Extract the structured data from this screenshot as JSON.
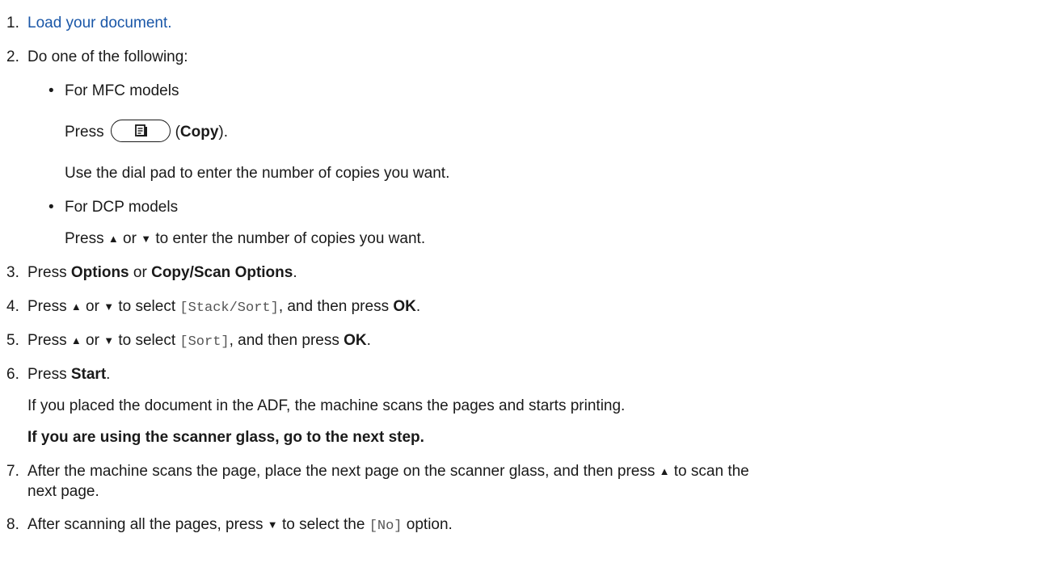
{
  "steps": {
    "s1": {
      "num": "1.",
      "link": "Load your document."
    },
    "s2": {
      "num": "2.",
      "text": "Do one of the following:"
    },
    "s2_mfc": {
      "bullet": "•",
      "heading": "For MFC models",
      "press": "Press",
      "button_icon": "copy-icon",
      "paren_open": "(",
      "button_label": "Copy",
      "paren_close": ").",
      "dial": "Use the dial pad to enter the number of copies you want."
    },
    "s2_dcp": {
      "bullet": "•",
      "heading": "For DCP models",
      "press": "Press ",
      "up": "▲",
      "or": " or ",
      "down": "▼",
      "rest": " to enter the number of copies you want."
    },
    "s3": {
      "num": "3.",
      "press": "Press ",
      "opt1": "Options",
      "or": " or ",
      "opt2": "Copy/Scan Options",
      "end": "."
    },
    "s4": {
      "num": "4.",
      "press": "Press ",
      "up": "▲",
      "or": " or ",
      "down": "▼",
      "mid": " to select ",
      "code": "[Stack/Sort]",
      "then": ", and then press ",
      "ok": "OK",
      "end": "."
    },
    "s5": {
      "num": "5.",
      "press": "Press ",
      "up": "▲",
      "or": " or ",
      "down": "▼",
      "mid": " to select ",
      "code": "[Sort]",
      "then": ", and then press ",
      "ok": "OK",
      "end": "."
    },
    "s6": {
      "num": "6.",
      "press": "Press ",
      "start": "Start",
      "end": ".",
      "adf": "If you placed the document in the ADF, the machine scans the pages and starts printing.",
      "glass": "If you are using the scanner glass, go to the next step."
    },
    "s7": {
      "num": "7.",
      "line1a": "After the machine scans the page, place the next page on the scanner glass, and then press ",
      "up": "▲",
      "line1b": " to scan the",
      "line2": "next page."
    },
    "s8": {
      "num": "8.",
      "a": "After scanning all the pages, press ",
      "down": "▼",
      "b": " to select the ",
      "code": "[No]",
      "c": " option."
    }
  },
  "colors": {
    "link": "#1a57a8",
    "text": "#1a1a1a",
    "code": "#555555"
  }
}
